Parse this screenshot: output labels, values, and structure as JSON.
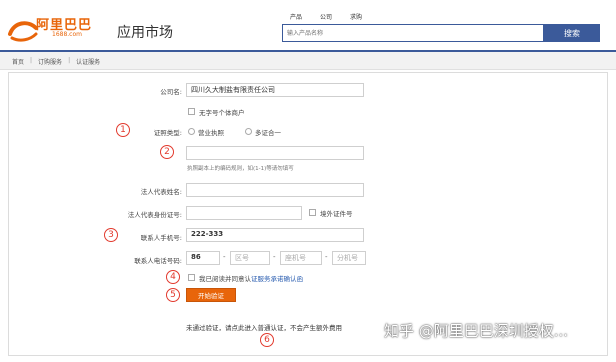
{
  "header": {
    "logo_text": "阿里巴巴",
    "logo_sub": "1688.com",
    "app_title": "应用市场",
    "search_tabs": [
      "产品",
      "公司",
      "求购"
    ],
    "search_placeholder": "输入产品名称",
    "search_button": "搜索"
  },
  "breadcrumb": [
    "首页",
    "订购服务",
    "认证服务"
  ],
  "form": {
    "company_label": "公司名:",
    "company_value": "四川久大制盐有限责任公司",
    "no_name_label": "无字号个体商户",
    "license_type_label": "证照类型:",
    "license_options": [
      "营业执照",
      "多证合一"
    ],
    "license_number_value": "",
    "license_hint": "执照副本上的编码规则，如(1-1)等请勿填写",
    "legal_rep_name_label": "法人代表姓名:",
    "legal_rep_name_value": "",
    "legal_rep_id_label": "法人代表身份证号:",
    "legal_rep_id_value": "",
    "foreign_id_label": "境外证件号",
    "contact_mobile_label": "联系人手机号:",
    "contact_mobile_value": "222-333",
    "contact_phone_label": "联系人电话号码:",
    "phone_country_value": "86",
    "phone_area_placeholder": "区号",
    "phone_number_placeholder": "座机号",
    "phone_ext_placeholder": "分机号",
    "agree_prefix": "我已阅读并同意认",
    "agree_link": "证服务承诺确认函",
    "submit_label": "开始验证",
    "footer_text": "未通过验证，请点此进入普通认证，不会产生额外费用"
  },
  "annotations": [
    "1",
    "2",
    "3",
    "4",
    "5",
    "6"
  ],
  "watermark": "知乎 @阿里巴巴深圳授权...",
  "colors": {
    "brand": "#e8650a",
    "nav": "#3b5a9a",
    "annotation": "#e23a2e"
  }
}
